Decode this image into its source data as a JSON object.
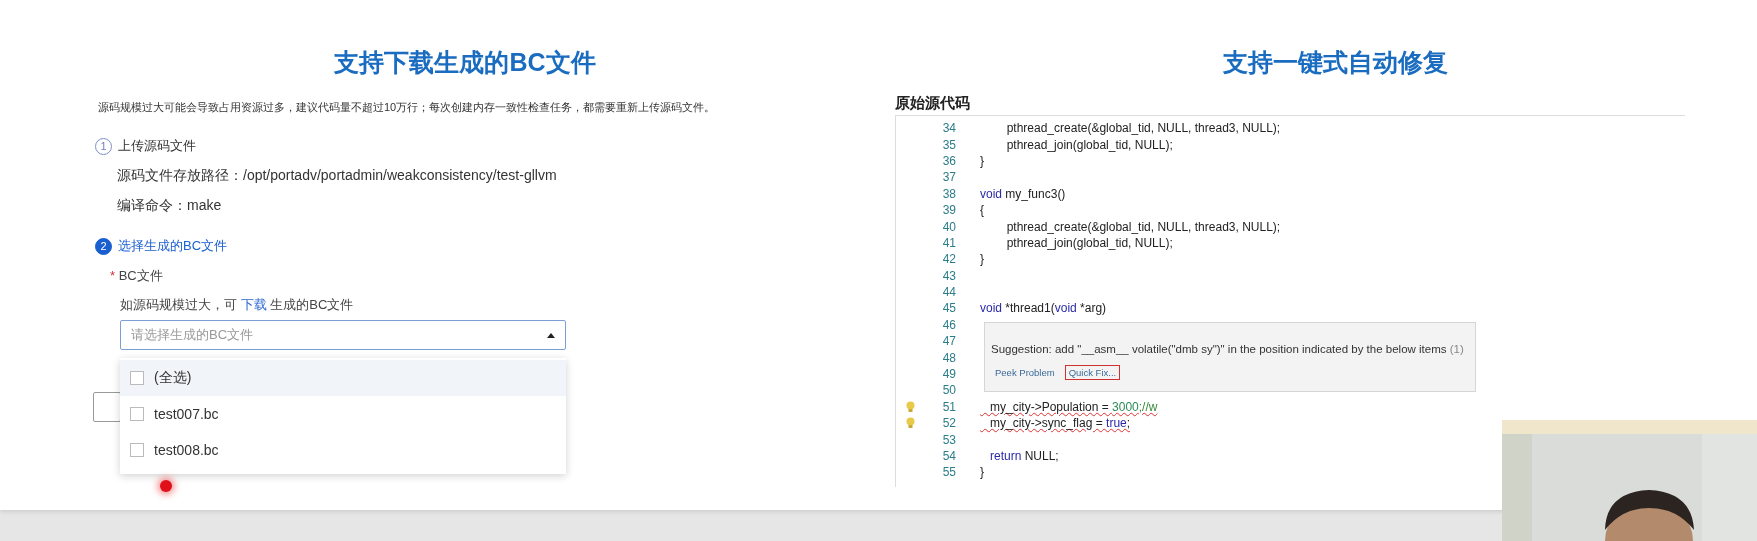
{
  "left_panel": {
    "title": "支持下载生成的BC文件",
    "note": "源码规模过大可能会导致占用资源过多，建议代码量不超过10万行；每次创建内存一致性检查任务，都需要重新上传源码文件。",
    "steps": [
      {
        "number": "1",
        "label": "上传源码文件",
        "active": false,
        "details": [
          "源码文件存放路径：/opt/portadv/portadmin/weakconsistency/test-gllvm",
          "编译命令：make"
        ]
      },
      {
        "number": "2",
        "label": "选择生成的BC文件",
        "active": true
      }
    ],
    "field": {
      "required_mark": "*",
      "label": "BC文件",
      "help_before": "如源码规模过大，可",
      "help_link": "下载",
      "help_after": "生成的BC文件",
      "placeholder": "请选择生成的BC文件",
      "expanded": true,
      "options": [
        {
          "label": "(全选)",
          "checked": false,
          "hovered": true
        },
        {
          "label": "test007.bc",
          "checked": false,
          "hovered": false
        },
        {
          "label": "test008.bc",
          "checked": false,
          "hovered": false
        }
      ]
    }
  },
  "right_panel": {
    "title": "支持一键式自动修复",
    "code_label": "原始源代码",
    "lines": [
      {
        "number": "34",
        "segments": [
          {
            "kind": "plain",
            "text": "        pthread_create(&global_tid, NULL, thread3, NULL);"
          }
        ]
      },
      {
        "number": "35",
        "segments": [
          {
            "kind": "plain",
            "text": "        pthread_join(global_tid, NULL);"
          }
        ]
      },
      {
        "number": "36",
        "segments": [
          {
            "kind": "plain",
            "text": "}"
          }
        ]
      },
      {
        "number": "37"
      },
      {
        "number": "38",
        "segments": [
          {
            "kind": "keyword",
            "text": "void"
          },
          {
            "kind": "plain",
            "text": " my_func3()"
          }
        ]
      },
      {
        "number": "39",
        "segments": [
          {
            "kind": "plain",
            "text": "{"
          }
        ]
      },
      {
        "number": "40",
        "segments": [
          {
            "kind": "plain",
            "text": "        pthread_create(&global_tid, NULL, thread3, NULL);"
          }
        ]
      },
      {
        "number": "41",
        "segments": [
          {
            "kind": "plain",
            "text": "        pthread_join(global_tid, NULL);"
          }
        ]
      },
      {
        "number": "42",
        "segments": [
          {
            "kind": "plain",
            "text": "}"
          }
        ]
      },
      {
        "number": "43"
      },
      {
        "number": "44"
      },
      {
        "number": "45",
        "segments": [
          {
            "kind": "keyword",
            "text": "void"
          },
          {
            "kind": "plain",
            "text": " *thread1("
          },
          {
            "kind": "keyword",
            "text": "void"
          },
          {
            "kind": "plain",
            "text": " *arg)"
          }
        ]
      },
      {
        "number": "46"
      },
      {
        "number": "47"
      },
      {
        "number": "48"
      },
      {
        "number": "49"
      },
      {
        "number": "50"
      },
      {
        "number": "51",
        "lightbulb": true,
        "squiggle": true,
        "segments": [
          {
            "kind": "plain",
            "text": "   my_city->Population = "
          },
          {
            "kind": "number",
            "text": "3000"
          },
          {
            "kind": "comment",
            "text": ";//w"
          }
        ]
      },
      {
        "number": "52",
        "lightbulb": true,
        "squiggle": true,
        "segments": [
          {
            "kind": "plain",
            "text": "   my_city->sync_flag = "
          },
          {
            "kind": "keyword",
            "text": "true"
          },
          {
            "kind": "plain",
            "text": ";"
          }
        ]
      },
      {
        "number": "53"
      },
      {
        "number": "54",
        "segments": [
          {
            "kind": "keyword",
            "text": "   return"
          },
          {
            "kind": "plain",
            "text": " NULL;"
          }
        ]
      },
      {
        "number": "55",
        "segments": [
          {
            "kind": "plain",
            "text": "}"
          }
        ]
      }
    ],
    "hover_popup": {
      "message": "Suggestion: add \"__asm__ volatile(\"dmb sy\")\" in the position indicated by the below items",
      "count": "(1)",
      "actions": [
        {
          "label": "Peek Problem",
          "selected": false
        },
        {
          "label": "Quick Fix...",
          "selected": true
        }
      ]
    }
  }
}
